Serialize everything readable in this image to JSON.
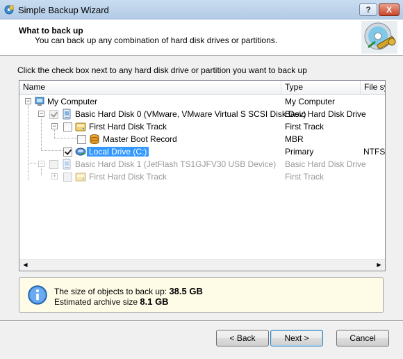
{
  "window": {
    "title": "Simple Backup Wizard",
    "help_button": "?",
    "close_button": "X"
  },
  "header": {
    "title": "What to back up",
    "subtitle": "You can back up any combination of hard disk drives or partitions."
  },
  "instruction": "Click the check box next to any hard disk drive or partition you want to back up",
  "tree": {
    "columns": [
      "Name",
      "Type",
      "File sys"
    ],
    "rows": [
      {
        "name": "My Computer",
        "type": "My Computer",
        "fs": "",
        "checked": false,
        "greyed": false,
        "selected": false
      },
      {
        "name": "Basic Hard Disk 0 (VMware, VMware Virtual S SCSI Disk Dev)",
        "type": "Basic Hard Disk Drive",
        "fs": "",
        "checked": true,
        "greyed": false,
        "selected": false
      },
      {
        "name": "First Hard Disk Track",
        "type": "First Track",
        "fs": "",
        "checked": false,
        "greyed": false,
        "selected": false
      },
      {
        "name": "Master Boot Record",
        "type": "MBR",
        "fs": "",
        "checked": false,
        "greyed": false,
        "selected": false
      },
      {
        "name": "Local Drive (C:)",
        "type": "Primary",
        "fs": "NTFS",
        "checked": true,
        "greyed": false,
        "selected": true
      },
      {
        "name": "Basic Hard Disk 1 (JetFlash TS1GJFV30 USB Device)",
        "type": "Basic Hard Disk Drive",
        "fs": "",
        "checked": false,
        "greyed": true,
        "selected": false
      },
      {
        "name": "First Hard Disk Track",
        "type": "First Track",
        "fs": "",
        "checked": false,
        "greyed": true,
        "selected": false
      }
    ]
  },
  "info": {
    "size_label": "The size of objects to back up:",
    "size_value": "38.5 GB",
    "archive_label": "Estimated archive size",
    "archive_value": "8.1 GB"
  },
  "buttons": {
    "back": "< Back",
    "next": "Next >",
    "cancel": "Cancel"
  },
  "icons": {
    "app": "backup-app-icon",
    "header_graphic": "disc-with-key-icon",
    "computer": "computer-icon",
    "disk": "hard-disk-icon",
    "track": "disk-track-icon",
    "mbr": "mbr-icon",
    "drive": "local-drive-icon",
    "info": "info-icon"
  },
  "colors": {
    "selection": "#3399ff",
    "info_panel_bg": "#fefbe7"
  }
}
